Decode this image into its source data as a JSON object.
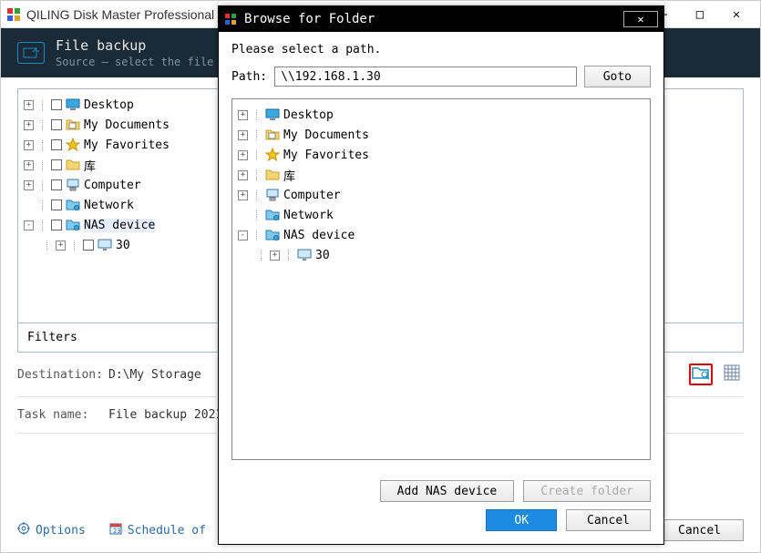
{
  "main_window": {
    "app_title": "QILING Disk Master Professional",
    "minimize": "—",
    "maximize": "□",
    "close": "✕"
  },
  "header": {
    "title": "File backup",
    "subtitle": "Source — select the file"
  },
  "source_tree": [
    {
      "expander": "+",
      "checked": false,
      "icon": "desktop",
      "label": "Desktop",
      "indent": 0
    },
    {
      "expander": "+",
      "checked": false,
      "icon": "folder-doc",
      "label": "My Documents",
      "indent": 0
    },
    {
      "expander": "+",
      "checked": false,
      "icon": "star",
      "label": "My Favorites",
      "indent": 0
    },
    {
      "expander": "+",
      "checked": false,
      "icon": "folder-yellow",
      "label": "库",
      "indent": 0
    },
    {
      "expander": "+",
      "checked": false,
      "icon": "computer",
      "label": "Computer",
      "indent": 0
    },
    {
      "expander": "",
      "checked": false,
      "icon": "network",
      "label": "Network",
      "indent": 0
    },
    {
      "expander": "-",
      "checked": false,
      "icon": "network",
      "label": "NAS device",
      "indent": 0,
      "selected": true
    },
    {
      "expander": "+",
      "checked": false,
      "icon": "monitor",
      "label": "30",
      "indent": 1
    }
  ],
  "filters": {
    "label": "Filters"
  },
  "destination": {
    "label": "Destination:",
    "value": "D:\\My Storage"
  },
  "task": {
    "label": "Task name:",
    "value": "File backup 2021-"
  },
  "bottom": {
    "options": "Options",
    "schedule": "Schedule of",
    "cancel": "Cancel"
  },
  "dialog": {
    "title": "Browse for Folder",
    "prompt": "Please select a path.",
    "path_label": "Path:",
    "path_value": "\\\\192.168.1.30",
    "goto": "Goto",
    "tree": [
      {
        "expander": "+",
        "icon": "desktop",
        "label": "Desktop",
        "indent": 0
      },
      {
        "expander": "+",
        "icon": "folder-doc",
        "label": "My Documents",
        "indent": 0
      },
      {
        "expander": "+",
        "icon": "star",
        "label": "My Favorites",
        "indent": 0
      },
      {
        "expander": "+",
        "icon": "folder-yellow",
        "label": "库",
        "indent": 0
      },
      {
        "expander": "+",
        "icon": "computer",
        "label": "Computer",
        "indent": 0
      },
      {
        "expander": "",
        "icon": "network",
        "label": "Network",
        "indent": 0
      },
      {
        "expander": "-",
        "icon": "network",
        "label": "NAS device",
        "indent": 0
      },
      {
        "expander": "+",
        "icon": "monitor",
        "label": "30",
        "indent": 1
      }
    ],
    "add_nas": "Add NAS device",
    "create_folder": "Create folder",
    "ok": "OK",
    "cancel": "Cancel"
  },
  "icons": {
    "desktop": "desktop-icon",
    "star": "star-icon",
    "folder": "folder-icon",
    "computer": "computer-icon",
    "network": "network-icon",
    "gear": "gear-icon",
    "calendar": "calendar-icon",
    "browse": "browse-folder-icon",
    "scheme": "scheme-icon"
  }
}
